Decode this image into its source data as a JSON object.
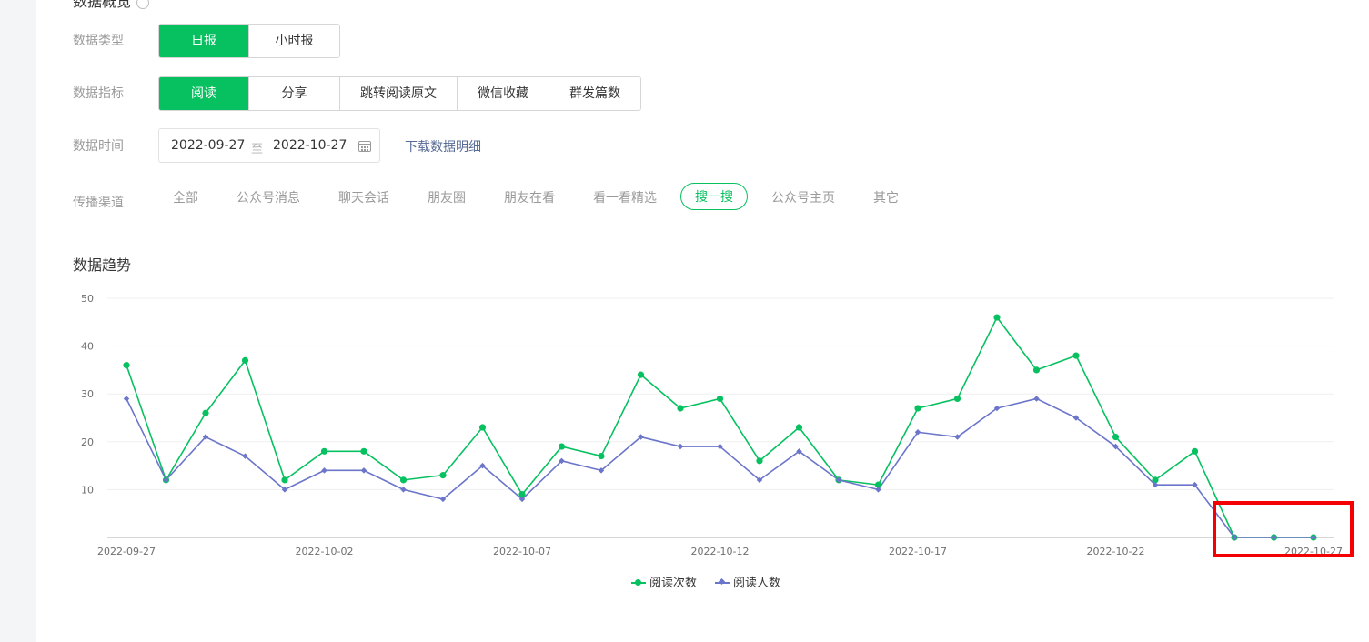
{
  "header": {
    "title_cut": "数据概览"
  },
  "filters": {
    "type": {
      "label": "数据类型",
      "options": [
        "日报",
        "小时报"
      ],
      "selected": "日报"
    },
    "metric": {
      "label": "数据指标",
      "options": [
        "阅读",
        "分享",
        "跳转阅读原文",
        "微信收藏",
        "群发篇数"
      ],
      "selected": "阅读"
    },
    "time": {
      "label": "数据时间",
      "start": "2022-09-27",
      "sep": "至",
      "end": "2022-10-27",
      "download": "下载数据明细"
    },
    "channel": {
      "label": "传播渠道",
      "options": [
        "全部",
        "公众号消息",
        "聊天会话",
        "朋友圈",
        "朋友在看",
        "看一看精选",
        "搜一搜",
        "公众号主页",
        "其它"
      ],
      "selected": "搜一搜"
    }
  },
  "trend": {
    "title": "数据趋势"
  },
  "chart_data": {
    "type": "line",
    "x": [
      "2022-09-27",
      "2022-09-28",
      "2022-09-29",
      "2022-09-30",
      "2022-10-01",
      "2022-10-02",
      "2022-10-03",
      "2022-10-04",
      "2022-10-05",
      "2022-10-06",
      "2022-10-07",
      "2022-10-08",
      "2022-10-09",
      "2022-10-10",
      "2022-10-11",
      "2022-10-12",
      "2022-10-13",
      "2022-10-14",
      "2022-10-15",
      "2022-10-16",
      "2022-10-17",
      "2022-10-18",
      "2022-10-19",
      "2022-10-20",
      "2022-10-21",
      "2022-10-22",
      "2022-10-23",
      "2022-10-24",
      "2022-10-25",
      "2022-10-26",
      "2022-10-27"
    ],
    "x_tick_labels": [
      "2022-09-27",
      "2022-10-02",
      "2022-10-07",
      "2022-10-12",
      "2022-10-17",
      "2022-10-22",
      "2022-10-27"
    ],
    "y_ticks": [
      10,
      20,
      30,
      40,
      50
    ],
    "ylim": [
      0,
      50
    ],
    "series": [
      {
        "name": "阅读次数",
        "color": "#07c160",
        "marker": "circle",
        "values": [
          36,
          12,
          26,
          37,
          12,
          18,
          18,
          12,
          13,
          23,
          9,
          19,
          17,
          34,
          27,
          29,
          16,
          23,
          12,
          11,
          27,
          29,
          46,
          35,
          38,
          21,
          12,
          18,
          0,
          0,
          0
        ]
      },
      {
        "name": "阅读人数",
        "color": "#6b75c9",
        "marker": "diamond",
        "values": [
          29,
          12,
          21,
          17,
          10,
          14,
          14,
          10,
          8,
          15,
          8,
          16,
          14,
          21,
          19,
          19,
          12,
          18,
          12,
          10,
          22,
          21,
          27,
          29,
          25,
          19,
          11,
          11,
          0,
          0,
          0
        ]
      }
    ],
    "grid": true,
    "legend": "bottom-center"
  },
  "annotation": {
    "highlight_color": "#f40000"
  }
}
